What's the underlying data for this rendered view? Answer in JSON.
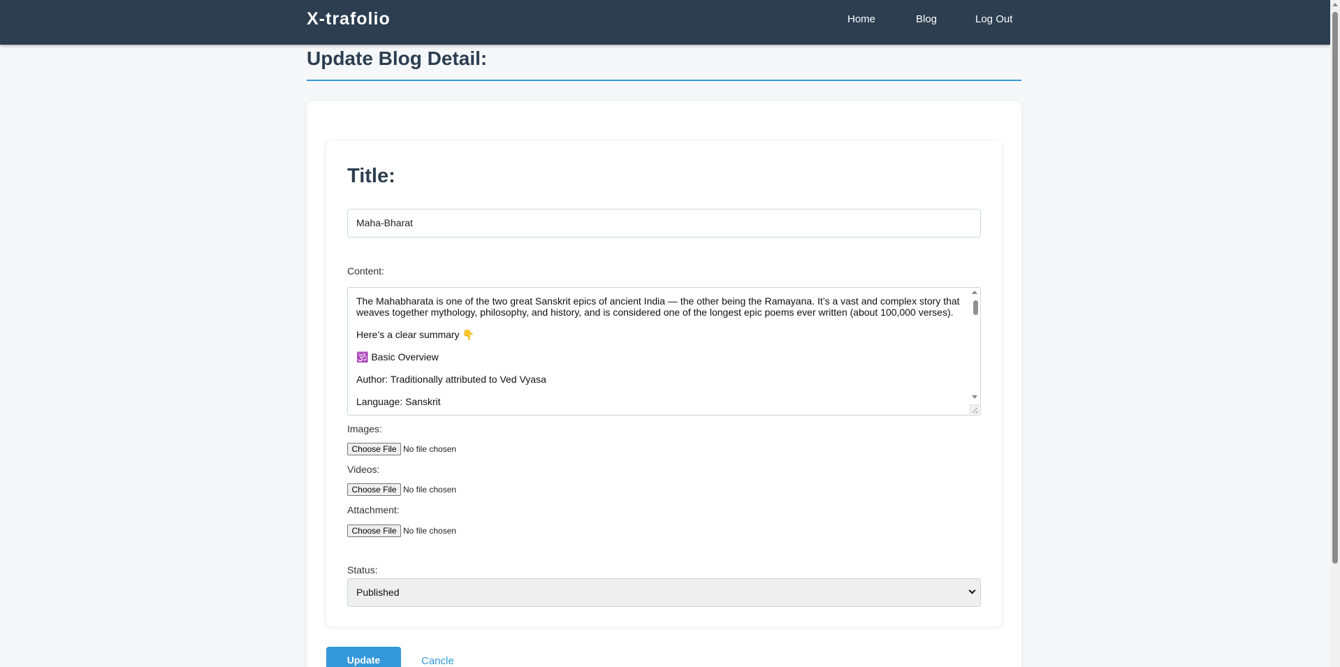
{
  "nav": {
    "brand": "X-trafolio",
    "links": [
      "Home",
      "Blog",
      "Log Out"
    ]
  },
  "page": {
    "title": "Update Blog Detail:"
  },
  "form": {
    "title_heading": "Title:",
    "title_value": "Maha-Bharat",
    "content_label": "Content:",
    "content_value": "The Mahabharata is one of the two great Sanskrit epics of ancient India — the other being the Ramayana. It’s a vast and complex story that weaves together mythology, philosophy, and history, and is considered one of the longest epic poems ever written (about 100,000 verses).\n\nHere’s a clear summary 👇\n\n🕉️ Basic Overview\n\nAuthor: Traditionally attributed to Ved Vyasa\n\nLanguage: Sanskrit",
    "images_label": "Images:",
    "videos_label": "Videos:",
    "attachment_label": "Attachment:",
    "file_button": "Choose File",
    "file_status": "No file chosen",
    "status_label": "Status:",
    "status_value": "Published",
    "update_button": "Update",
    "cancel_link": "Cancle"
  },
  "colors": {
    "navbar": "#2c3e50",
    "accent": "#3498db",
    "page_bg": "#f5f7f9"
  },
  "icons": {
    "select_chevron": "chevron-down-icon",
    "textarea_resize": "resize-grip-icon"
  }
}
